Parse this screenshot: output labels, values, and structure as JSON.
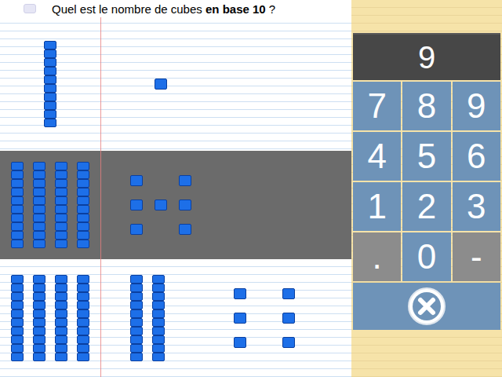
{
  "question": {
    "prefix": "Quel est le nombre de cubes ",
    "bold": "en base 10",
    "suffix": " ?"
  },
  "rows": [
    {
      "selected": false,
      "columns": [
        {
          "kind": "rods",
          "count": 1
        },
        {
          "kind": "units",
          "count": 1
        },
        {
          "kind": "empty",
          "count": 0
        }
      ]
    },
    {
      "selected": true,
      "columns": [
        {
          "kind": "rods",
          "count": 4
        },
        {
          "kind": "units",
          "count": 7
        },
        {
          "kind": "empty",
          "count": 0
        }
      ]
    },
    {
      "selected": false,
      "columns": [
        {
          "kind": "rods",
          "count": 4
        },
        {
          "kind": "rods",
          "count": 2
        },
        {
          "kind": "units",
          "count": 6
        }
      ]
    }
  ],
  "display": "9",
  "keys": [
    {
      "label": "7",
      "kind": "digit"
    },
    {
      "label": "8",
      "kind": "digit"
    },
    {
      "label": "9",
      "kind": "digit"
    },
    {
      "label": "4",
      "kind": "digit"
    },
    {
      "label": "5",
      "kind": "digit"
    },
    {
      "label": "6",
      "kind": "digit"
    },
    {
      "label": "1",
      "kind": "digit"
    },
    {
      "label": "2",
      "kind": "digit"
    },
    {
      "label": "3",
      "kind": "digit"
    },
    {
      "label": ".",
      "kind": "symbol"
    },
    {
      "label": "0",
      "kind": "digit"
    },
    {
      "label": "-",
      "kind": "symbol"
    }
  ]
}
